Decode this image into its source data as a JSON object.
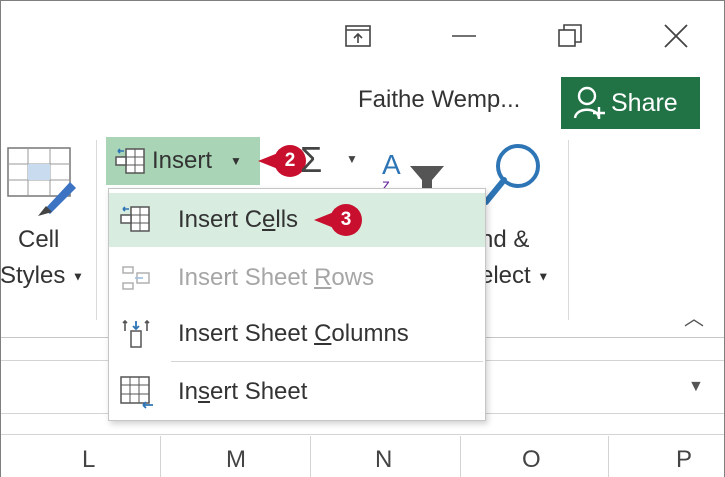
{
  "window": {
    "user_name": "Faithe Wemp...",
    "share_label": "Share",
    "controls": [
      "ribbon-display-options",
      "minimize",
      "restore",
      "close"
    ]
  },
  "ribbon": {
    "cell_styles_line1": "Cell",
    "cell_styles_line2": "Styles",
    "insert_label": "Insert",
    "sigma_label": "Σ",
    "find_line1": "nd &",
    "find_line2": "elect"
  },
  "callouts": {
    "step2": "2",
    "step3": "3"
  },
  "insert_menu": {
    "items": [
      {
        "label_pre": "Insert C",
        "label_key": "e",
        "label_post": "lls",
        "icon": "insert-cells-icon",
        "highlighted": true,
        "disabled": false
      },
      {
        "label_pre": "Insert Sheet ",
        "label_key": "R",
        "label_post": "ows",
        "icon": "insert-rows-icon",
        "highlighted": false,
        "disabled": true
      },
      {
        "label_pre": "Insert Sheet ",
        "label_key": "C",
        "label_post": "olumns",
        "icon": "insert-columns-icon",
        "highlighted": false,
        "disabled": false
      },
      {
        "label_pre": "In",
        "label_key": "s",
        "label_post": "ert Sheet",
        "icon": "insert-sheet-icon",
        "highlighted": false,
        "disabled": false
      }
    ]
  },
  "columns": [
    "L",
    "M",
    "N",
    "O",
    "P"
  ],
  "colors": {
    "accent": "#217346",
    "insert_highlight": "#a9d5b6",
    "menu_highlight": "#d8ece0",
    "callout": "#c8102e"
  }
}
